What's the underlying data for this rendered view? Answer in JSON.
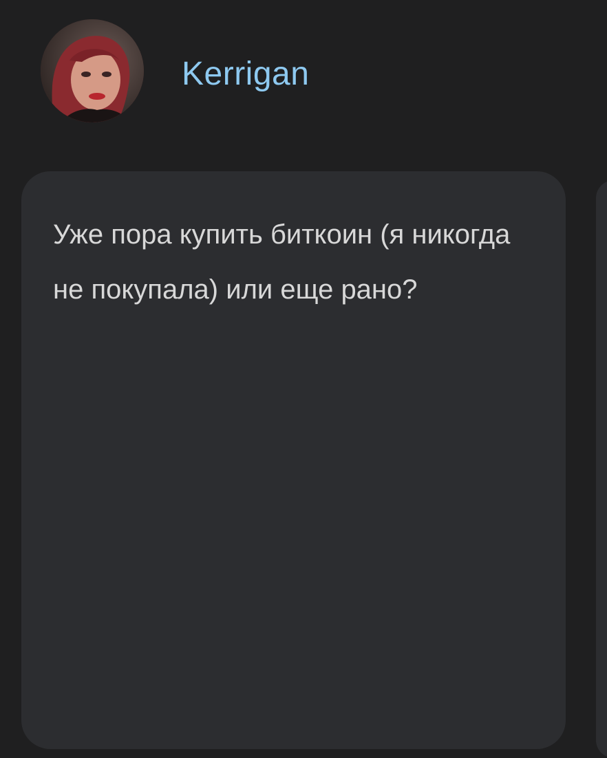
{
  "post": {
    "author": {
      "name": "Kerrigan",
      "avatar_icon": "user-avatar"
    },
    "text": "Уже пора купить биткоин (я никогда не покупала) или еще рано?"
  },
  "colors": {
    "background": "#1f1f20",
    "card": "#2c2d30",
    "author_name": "#8ec9f0",
    "text": "#d8d8d8"
  }
}
